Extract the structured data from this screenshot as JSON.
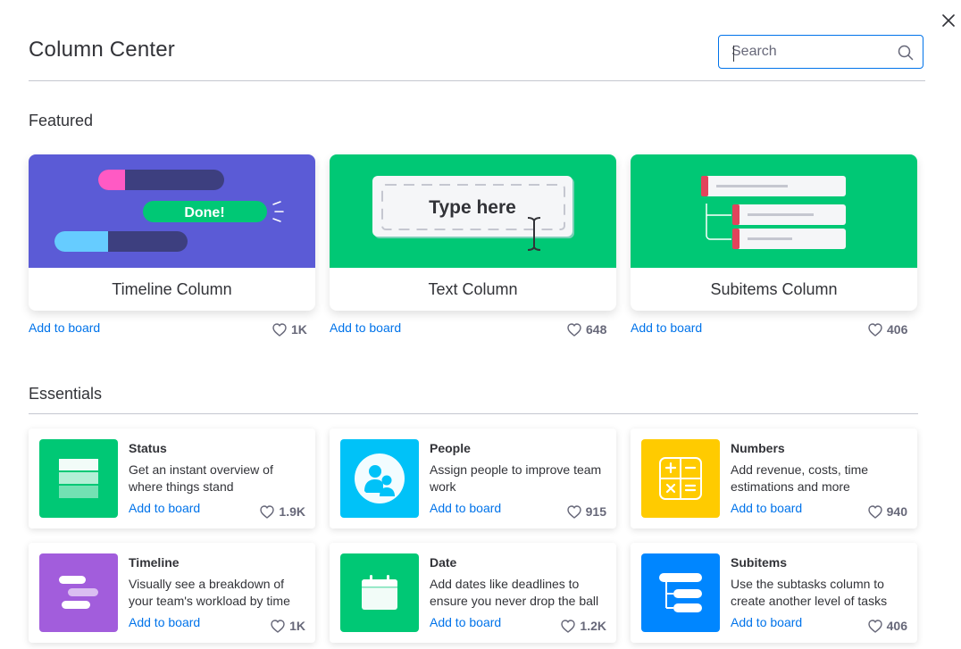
{
  "title": "Column Center",
  "search": {
    "placeholder": "Search"
  },
  "sections": {
    "featured": "Featured",
    "essentials": "Essentials"
  },
  "colors": {
    "accent": "#0073ea",
    "timeline_bg": "#5b5bd6",
    "text_bg": "#00c875",
    "subitems_bg": "#00c875",
    "status_icon": "#00c875",
    "people_icon": "#00c2f8",
    "numbers_icon": "#ffcb00",
    "timeline_icon": "#a25ddc",
    "date_icon": "#00c875",
    "subitems_icon": "#0086ff"
  },
  "featured": [
    {
      "name": "Timeline Column",
      "add": "Add to board",
      "likes": "1K",
      "art": {
        "done_label": "Done!"
      }
    },
    {
      "name": "Text Column",
      "add": "Add to board",
      "likes": "648",
      "art": {
        "type_label": "Type here"
      }
    },
    {
      "name": "Subitems Column",
      "add": "Add to board",
      "likes": "406"
    }
  ],
  "essentials": [
    {
      "name": "Status",
      "desc": "Get an instant overview of where things stand",
      "add": "Add to board",
      "likes": "1.9K",
      "icon": "status-icon"
    },
    {
      "name": "People",
      "desc": "Assign people to improve team work",
      "add": "Add to board",
      "likes": "915",
      "icon": "people-icon"
    },
    {
      "name": "Numbers",
      "desc": "Add revenue, costs, time estimations and more",
      "add": "Add to board",
      "likes": "940",
      "icon": "numbers-icon"
    },
    {
      "name": "Timeline",
      "desc": "Visually see a breakdown of your team's workload by time",
      "add": "Add to board",
      "likes": "1K",
      "icon": "timeline-icon"
    },
    {
      "name": "Date",
      "desc": "Add dates like deadlines to ensure you never drop the ball",
      "add": "Add to board",
      "likes": "1.2K",
      "icon": "calendar-icon"
    },
    {
      "name": "Subitems",
      "desc": "Use the subtasks column to create another level of tasks",
      "add": "Add to board",
      "likes": "406",
      "icon": "subitems-icon"
    }
  ]
}
